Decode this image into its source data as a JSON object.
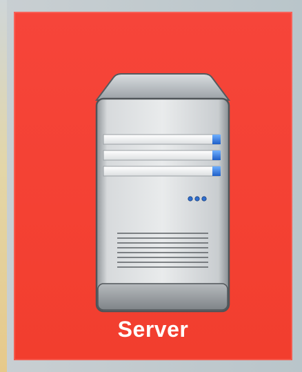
{
  "tile": {
    "label": "Server",
    "background_color": "#f3412f",
    "icon": "server-icon"
  },
  "colors": {
    "accent_blue": "#2f7fe0",
    "led": "#2f6fd0"
  }
}
